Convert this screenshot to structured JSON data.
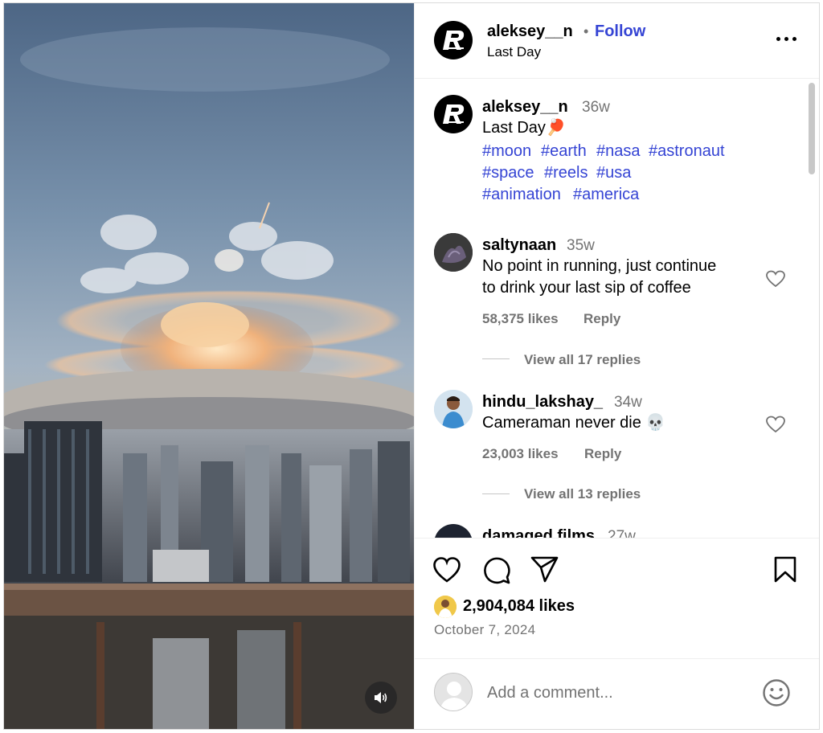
{
  "post": {
    "author": "aleksey__n",
    "follow_label": "Follow",
    "separator": "•",
    "subtitle": "Last Day",
    "caption": {
      "username": "aleksey__n",
      "age": "36w",
      "text": "Last Day",
      "emoji": "🏓",
      "hashtags": [
        "#moon",
        "#earth",
        "#nasa",
        "#astronaut",
        "#space",
        "#reels",
        "#usa",
        "#animation",
        "#america"
      ]
    }
  },
  "comments": [
    {
      "username": "saltynaan",
      "age": "35w",
      "line1": "No point in running, just continue",
      "line2": "to drink your last sip of coffee",
      "likes": "58,375 likes",
      "reply_label": "Reply",
      "view_replies": "View all 17 replies"
    },
    {
      "username": "hindu_lakshay_",
      "age": "34w",
      "line1": "Cameraman never die 💀",
      "likes": "23,003 likes",
      "reply_label": "Reply",
      "view_replies": "View all 13 replies"
    },
    {
      "username": "damaged.films",
      "age": "27w"
    }
  ],
  "footer": {
    "likes_count": "2,904,084 likes",
    "date": "October 7, 2024",
    "comment_placeholder": "Add a comment..."
  },
  "icons": {
    "more": "more-options-icon",
    "like": "heart-icon",
    "comment": "comment-icon",
    "share": "share-icon",
    "save": "bookmark-icon",
    "emoji": "emoji-icon",
    "mute": "volume-icon"
  },
  "colors": {
    "link_blue": "#3544d4",
    "secondary_text": "#737373",
    "border": "#dbdbdb"
  }
}
